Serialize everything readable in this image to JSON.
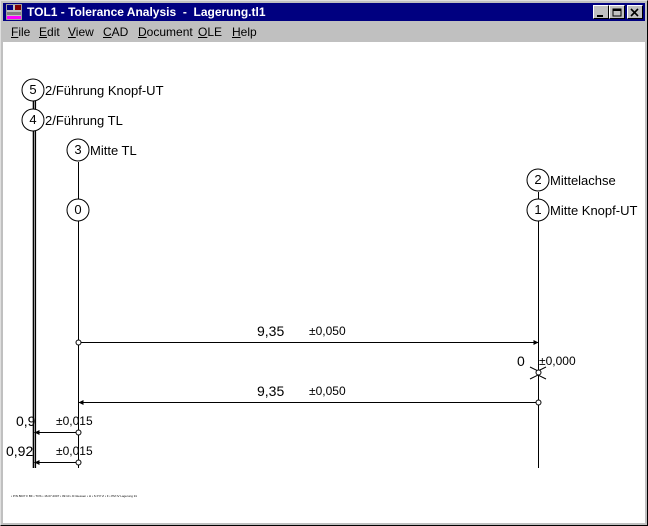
{
  "window": {
    "title": "TOL1 - Tolerance Analysis  -  Lagerung.tl1"
  },
  "menu": {
    "items": [
      {
        "acc": "F",
        "rest": "ile"
      },
      {
        "acc": "E",
        "rest": "dit"
      },
      {
        "acc": "V",
        "rest": "iew"
      },
      {
        "acc": "C",
        "rest": "AD"
      },
      {
        "acc": "D",
        "rest": "ocument"
      },
      {
        "acc": "O",
        "rest": "LE"
      },
      {
        "acc": "H",
        "rest": "elp"
      }
    ]
  },
  "drawing": {
    "nodes": [
      {
        "number": "5",
        "label": "2/Führung Knopf-UT"
      },
      {
        "number": "4",
        "label": "2/Führung TL"
      },
      {
        "number": "3",
        "label": "Mitte TL"
      },
      {
        "number": "0",
        "label": ""
      },
      {
        "number": "2",
        "label": "Mittelachse"
      },
      {
        "number": "1",
        "label": "Mitte Knopf-UT"
      }
    ],
    "dimensions": [
      {
        "value": "9,35",
        "tolerance": "±0,050"
      },
      {
        "value": "0",
        "tolerance": "±0,000"
      },
      {
        "value": "9,35",
        "tolerance": "±0,050"
      },
      {
        "value": "0,9",
        "tolerance": "±0,015"
      },
      {
        "value": "0,92",
        "tolerance": "±0,015"
      }
    ],
    "footer_text": "• P/N 8037 F BF • TOS • 16.07.2007 • 09:10 • D:\\Hessen • H • S P P Z • F • PM IV Lagerung tl1"
  },
  "colors": {
    "titlebar": "#000080",
    "chrome": "#c0c0c0",
    "canvas": "#ffffff"
  }
}
